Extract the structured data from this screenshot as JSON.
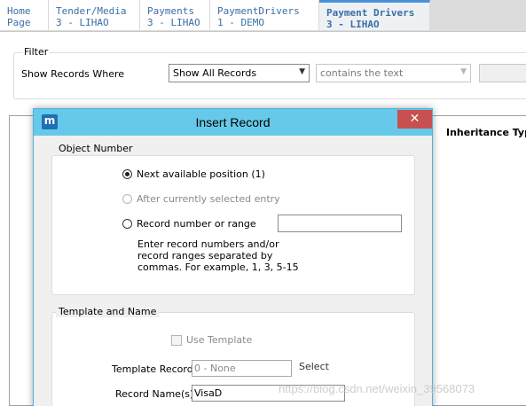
{
  "tabs": [
    {
      "line1": "Home",
      "line2": "Page"
    },
    {
      "line1": "Tender/Media",
      "line2": "3 - LIHAO"
    },
    {
      "line1": "Payments",
      "line2": "3 - LIHAO"
    },
    {
      "line1": "PaymentDrivers",
      "line2": "1 - DEMO"
    },
    {
      "line1": "Payment Drivers",
      "line2": "3 - LIHAO",
      "active": true
    }
  ],
  "filter": {
    "title": "Filter",
    "label": "Show Records Where",
    "field_value": "Show All Records",
    "operator_value": "contains the text"
  },
  "grid": {
    "column_header": "Inheritance Type"
  },
  "dialog": {
    "title": "Insert Record",
    "close_glyph": "✕",
    "logo_letter": "m",
    "object_number": {
      "title": "Object Number",
      "options": [
        {
          "label": "Next available position (1)",
          "checked": true,
          "enabled": true
        },
        {
          "label": "After currently selected entry",
          "checked": false,
          "enabled": false
        },
        {
          "label": "Record number or range",
          "checked": false,
          "enabled": true
        }
      ],
      "range_value": "",
      "help_text": "Enter record numbers and/or record ranges separated by commas. For example, 1, 3, 5-15"
    },
    "template_name": {
      "title": "Template and Name",
      "use_template_label": "Use Template",
      "use_template_checked": false,
      "template_record_label": "Template Record",
      "template_record_value": "0 - None",
      "select_label": "Select",
      "record_name_label": "Record Name(s)",
      "record_name_value": "VisaD"
    }
  },
  "watermark": "https://blog.csdn.net/weixin_39568073",
  "colors": {
    "titlebar": "#66c9e9",
    "close_button": "#c75050",
    "tab_text": "#3a6ea5",
    "logo": "#1f6fb5"
  }
}
